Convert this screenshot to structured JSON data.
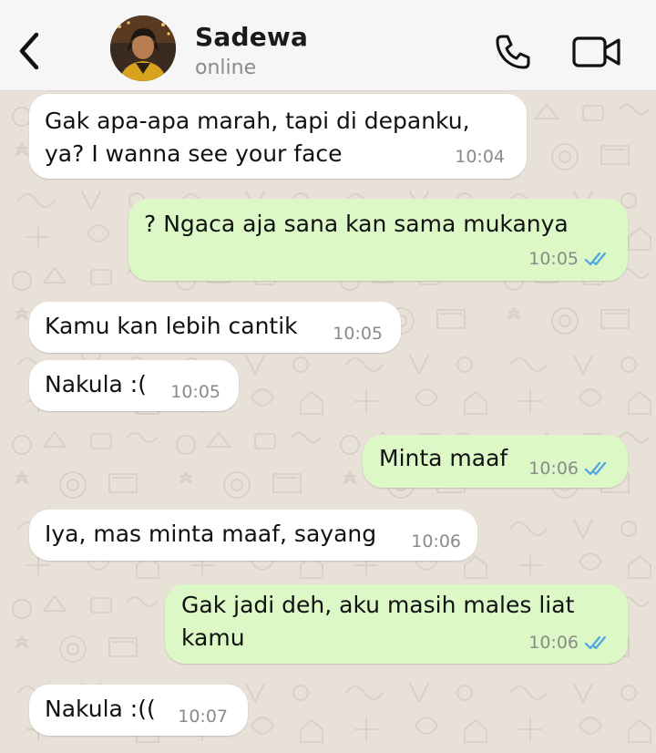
{
  "header": {
    "contact_name": "Sadewa",
    "contact_status": "online",
    "back_icon": "chevron-left-icon",
    "call_icon": "phone-icon",
    "video_icon": "video-camera-icon"
  },
  "colors": {
    "header_bg": "#f6f6f6",
    "chat_bg": "#e8e1d8",
    "incoming_bubble": "#ffffff",
    "outgoing_bubble": "#dbf8c6",
    "read_ticks": "#4fa6e0",
    "timestamp": "#8a8a8a"
  },
  "messages": [
    {
      "direction": "in",
      "text": "Gak apa-apa marah, tapi di depanku,\nya? I wanna see your face",
      "time": "10:04"
    },
    {
      "direction": "out",
      "text": "? Ngaca aja sana kan sama mukanya",
      "time": "10:05",
      "status": "read"
    },
    {
      "direction": "in",
      "text": "Kamu kan lebih cantik",
      "time": "10:05"
    },
    {
      "direction": "in",
      "text": "Nakula :(",
      "time": "10:05"
    },
    {
      "direction": "out",
      "text": "Minta maaf",
      "time": "10:06",
      "status": "read"
    },
    {
      "direction": "in",
      "text": "Iya, mas minta maaf, sayang",
      "time": "10:06"
    },
    {
      "direction": "out",
      "text": "Gak jadi deh, aku masih males liat\nkamu",
      "time": "10:06",
      "status": "read"
    },
    {
      "direction": "in",
      "text": "Nakula :((",
      "time": "10:07"
    }
  ]
}
